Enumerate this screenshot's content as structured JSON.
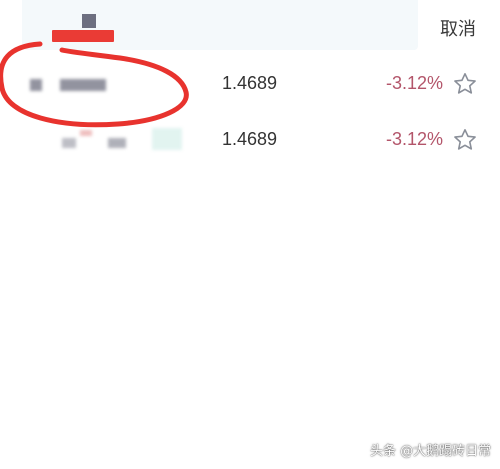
{
  "header": {
    "cancel_label": "取消"
  },
  "results": [
    {
      "nav": "1.4689",
      "change": "-3.12%",
      "favorite_icon": "star-outline-icon"
    },
    {
      "nav": "1.4689",
      "change": "-3.12%",
      "favorite_icon": "star-outline-icon"
    }
  ],
  "colors": {
    "change_negative": "#b3556a",
    "annotation_red": "#ea3b35",
    "search_bg": "#f4f9fb"
  },
  "watermark": "头条 @大鹅蹋砖日常"
}
